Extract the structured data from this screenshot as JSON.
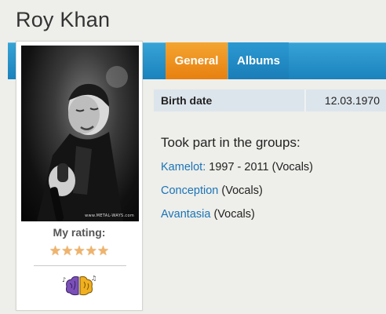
{
  "artist": {
    "name": "Roy Khan"
  },
  "tabs": [
    {
      "label": "General",
      "active": true
    },
    {
      "label": "Albums",
      "active": false
    }
  ],
  "profile": {
    "photo_watermark": "www.METAL-WAYS.com",
    "rating_label": "My rating:",
    "rating_stars": 5,
    "rating_icon": "brain-icon"
  },
  "info": {
    "birth_date_label": "Birth date",
    "birth_date_value": "12.03.1970"
  },
  "groups": {
    "heading": "Took part in the groups:",
    "items": [
      {
        "name": "Kamelot",
        "suffix": ":",
        "detail": " 1997 - 2011 (Vocals)"
      },
      {
        "name": "Conception",
        "suffix": "",
        "detail": " (Vocals)"
      },
      {
        "name": "Avantasia",
        "suffix": "",
        "detail": " (Vocals)"
      }
    ]
  },
  "colors": {
    "tab_active": "#e7800f",
    "bar_blue": "#1a82bd",
    "link": "#1a74b8",
    "star": "#f0b36a"
  }
}
